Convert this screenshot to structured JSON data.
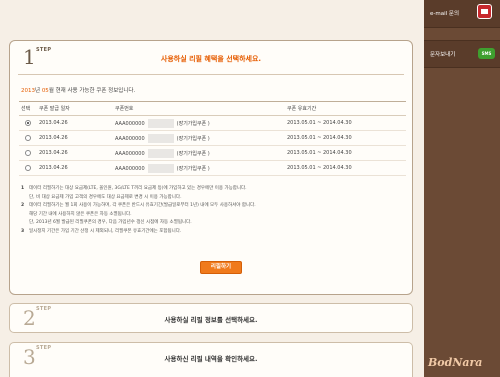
{
  "step1": {
    "number": "1",
    "label": "STEP",
    "title": "사용하실 리필 혜택을 선택하세요.",
    "info_year": "2013",
    "info_year_suffix": "년",
    "info_month": "05",
    "info_text": "월 현재 사용 가능한 쿠폰 정보입니다.",
    "table": {
      "headers": [
        "선택",
        "쿠폰 발급 일자",
        "쿠폰번호",
        "쿠폰 유효기간"
      ],
      "rows": [
        {
          "selected": true,
          "date": "2013.04.26",
          "code": "AAA000000",
          "type": "(장기가입쿠폰 )",
          "validity": "2013.05.01 ~ 2014.04.30"
        },
        {
          "selected": false,
          "date": "2013.04.26",
          "code": "AAA000000",
          "type": "(장기가입쿠폰 )",
          "validity": "2013.05.01 ~ 2014.04.30"
        },
        {
          "selected": false,
          "date": "2013.04.26",
          "code": "AAA000000",
          "type": "(장기가입쿠폰 )",
          "validity": "2013.05.01 ~ 2014.04.30"
        },
        {
          "selected": false,
          "date": "2013.04.26",
          "code": "AAA000000",
          "type": "(장기가입쿠폰 )",
          "validity": "2013.05.01 ~ 2014.04.30"
        }
      ]
    },
    "notes": {
      "n1": "1",
      "n1_text": "데이터 리필하기는 대상 요금제(LTE, 올인원, 3G/LTE T끼리 요금제 등)에 가입하고 있는 경우에만 이용 가능합니다.",
      "n1_sub": "단, 비 대상 요금제 가입 고객의 경우에도 대상 요금제로 변경 시 이용 가능합니다.",
      "n2": "2",
      "n2_text": "데이터 리필하기는 월 1회 사용이 가능하며, 각 쿠폰은 반드시 유효기간(발급일로부터 1년) 내에 모두 사용하셔야 합니다.",
      "n2_sub1": "해당 기간 내에 사용하지 않은 쿠폰은 자동 소멸됩니다.",
      "n2_sub2": "단, 2013년 6월 발급된 리필쿠폰의 경우, 다음 가입년수 갱신 시점에 자동 소멸됩니다.",
      "n3": "3",
      "n3_text": "일시정지 기간은 가입 기간 산정 시 제외되니, 리필쿠폰 유효기간에는 포함됩니다."
    },
    "apply_button": "리필하기"
  },
  "step2": {
    "number": "2",
    "label": "STEP",
    "title": "사용하실 리필 정보를 선택하세요."
  },
  "step3": {
    "number": "3",
    "label": "STEP",
    "title": "사용하신 리필 내역을 확인하세요."
  },
  "sidebar": {
    "email_label": "e-mail 문의",
    "sms_label": "문자보내기",
    "sms_icon_text": "SMS"
  },
  "watermark": "BodNara",
  "colors": {
    "accent": "#e65c00",
    "button": "#f07a1c",
    "sidebar": "#6b4a35"
  }
}
